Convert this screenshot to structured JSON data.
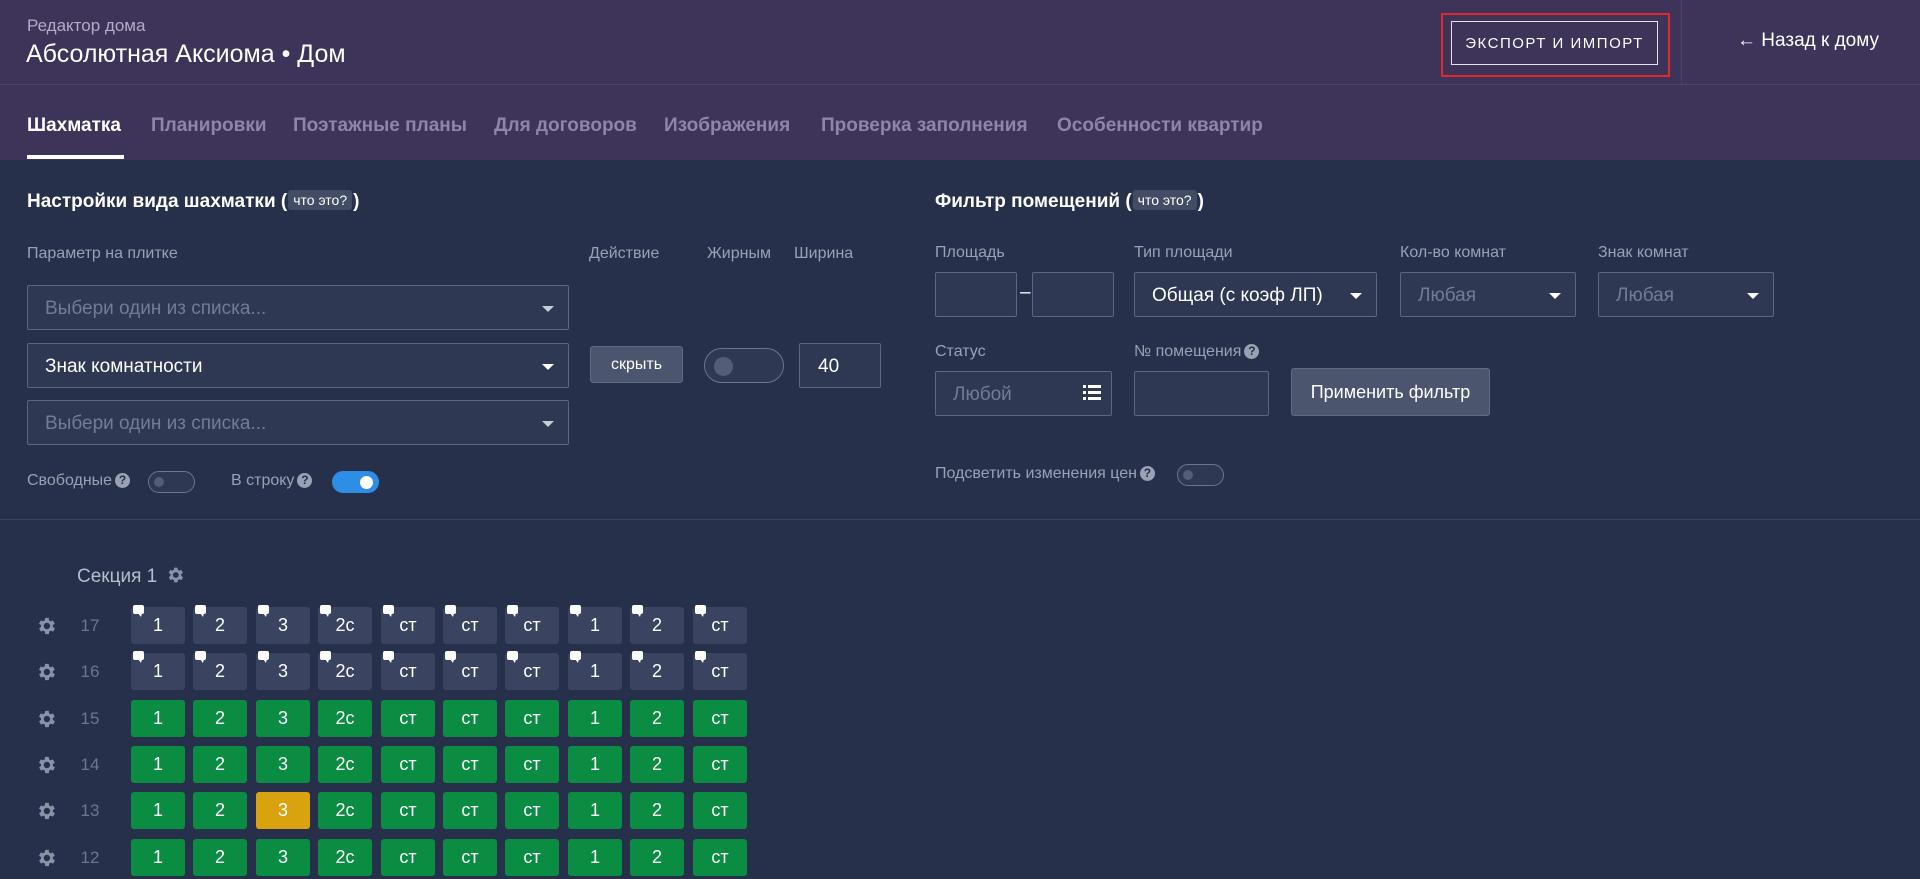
{
  "header": {
    "subtitle": "Редактор дома",
    "title": "Абсолютная Аксиома • Дом",
    "export_label": "ЭКСПОРТ И ИМПОРТ",
    "back_label": "← Назад к дому"
  },
  "tabs": [
    {
      "label": "Шахматка",
      "active": true
    },
    {
      "label": "Планировки"
    },
    {
      "label": "Поэтажные планы"
    },
    {
      "label": "Для договоров"
    },
    {
      "label": "Изображения"
    },
    {
      "label": "Проверка заполнения"
    },
    {
      "label": "Особенности квартир"
    }
  ],
  "view_settings": {
    "title": "Настройки вида шахматки",
    "whatis": "что это?",
    "col_param": "Параметр на плитке",
    "col_action": "Действие",
    "col_bold": "Жирным",
    "col_width": "Ширина",
    "param1_placeholder": "Выбери один из списка...",
    "param2_value": "Знак комнатности",
    "param3_placeholder": "Выбери один из списка...",
    "hide_label": "скрыть",
    "width_value": "40",
    "bold_on": false,
    "free_label": "Свободные",
    "free_on": false,
    "inline_label": "В строку",
    "inline_on": true
  },
  "filter": {
    "title": "Фильтр помещений",
    "whatis": "что это?",
    "area_label": "Площадь",
    "area_dash": "–",
    "area_type_label": "Тип площади",
    "area_type_value": "Общая (с коэф ЛП)",
    "rooms_label": "Кол-во комнат",
    "rooms_value": "Любая",
    "rooms_sign_label": "Знак комнат",
    "rooms_sign_value": "Любая",
    "status_label": "Статус",
    "status_value": "Любой",
    "number_label": "№ помещения",
    "apply_label": "Применить фильтр",
    "highlight_label": "Подсветить изменения цен",
    "highlight_on": false
  },
  "chess": {
    "section_label": "Секция 1",
    "colors": {
      "grey": "#3a4460",
      "green": "#0a8c43",
      "yellow": "#d9a30f"
    },
    "floors": [
      {
        "num": "17",
        "cells": [
          [
            "1",
            "grey",
            1
          ],
          [
            "2",
            "grey",
            1
          ],
          [
            "3",
            "grey",
            1
          ],
          [
            "2с",
            "grey",
            1
          ],
          [
            "ст",
            "grey",
            1
          ],
          [
            "ст",
            "grey",
            1
          ],
          [
            "ст",
            "grey",
            1
          ],
          [
            "1",
            "grey",
            1
          ],
          [
            "2",
            "grey",
            1
          ],
          [
            "ст",
            "grey",
            1
          ]
        ]
      },
      {
        "num": "16",
        "cells": [
          [
            "1",
            "grey",
            1
          ],
          [
            "2",
            "grey",
            1
          ],
          [
            "3",
            "grey",
            1
          ],
          [
            "2с",
            "grey",
            1
          ],
          [
            "ст",
            "grey",
            1
          ],
          [
            "ст",
            "grey",
            1
          ],
          [
            "ст",
            "grey",
            1
          ],
          [
            "1",
            "grey",
            1
          ],
          [
            "2",
            "grey",
            1
          ],
          [
            "ст",
            "grey",
            1
          ]
        ]
      },
      {
        "num": "15",
        "cells": [
          [
            "1",
            "green",
            0
          ],
          [
            "2",
            "green",
            0
          ],
          [
            "3",
            "green",
            0
          ],
          [
            "2с",
            "green",
            0
          ],
          [
            "ст",
            "green",
            0
          ],
          [
            "ст",
            "green",
            0
          ],
          [
            "ст",
            "green",
            0
          ],
          [
            "1",
            "green",
            0
          ],
          [
            "2",
            "green",
            0
          ],
          [
            "ст",
            "green",
            0
          ]
        ]
      },
      {
        "num": "14",
        "cells": [
          [
            "1",
            "green",
            0
          ],
          [
            "2",
            "green",
            0
          ],
          [
            "3",
            "green",
            0
          ],
          [
            "2с",
            "green",
            0
          ],
          [
            "ст",
            "green",
            0
          ],
          [
            "ст",
            "green",
            0
          ],
          [
            "ст",
            "green",
            0
          ],
          [
            "1",
            "green",
            0
          ],
          [
            "2",
            "green",
            0
          ],
          [
            "ст",
            "green",
            0
          ]
        ]
      },
      {
        "num": "13",
        "cells": [
          [
            "1",
            "green",
            0
          ],
          [
            "2",
            "green",
            0
          ],
          [
            "3",
            "yellow",
            0
          ],
          [
            "2с",
            "green",
            0
          ],
          [
            "ст",
            "green",
            0
          ],
          [
            "ст",
            "green",
            0
          ],
          [
            "ст",
            "green",
            0
          ],
          [
            "1",
            "green",
            0
          ],
          [
            "2",
            "green",
            0
          ],
          [
            "ст",
            "green",
            0
          ]
        ]
      },
      {
        "num": "12",
        "cells": [
          [
            "1",
            "green",
            0
          ],
          [
            "2",
            "green",
            0
          ],
          [
            "3",
            "green",
            0
          ],
          [
            "2с",
            "green",
            0
          ],
          [
            "ст",
            "green",
            0
          ],
          [
            "ст",
            "green",
            0
          ],
          [
            "ст",
            "green",
            0
          ],
          [
            "1",
            "green",
            0
          ],
          [
            "2",
            "green",
            0
          ],
          [
            "ст",
            "green",
            0
          ]
        ]
      }
    ]
  }
}
